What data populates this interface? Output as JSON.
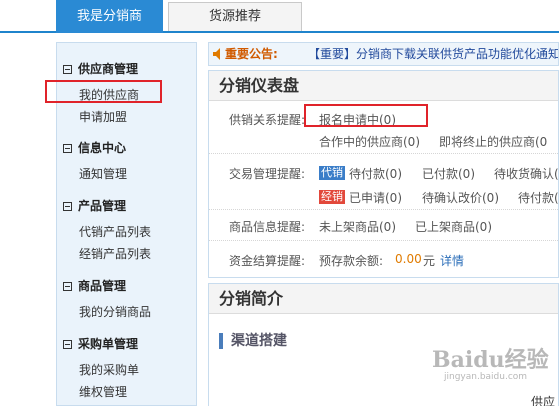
{
  "tabs": {
    "active": "我是分销商",
    "other": "货源推荐"
  },
  "sidebar": {
    "groups": [
      {
        "title": "供应商管理",
        "items": [
          "我的供应商",
          "申请加盟"
        ]
      },
      {
        "title": "信息中心",
        "items": [
          "通知管理"
        ]
      },
      {
        "title": "产品管理",
        "items": [
          "代销产品列表",
          "经销产品列表"
        ]
      },
      {
        "title": "商品管理",
        "items": [
          "我的分销商品"
        ]
      },
      {
        "title": "采购单管理",
        "items": [
          "我的采购单",
          "维权管理"
        ]
      }
    ]
  },
  "notice": {
    "label": "重要公告:",
    "message": "【重要】分销商下载关联供货产品功能优化通知"
  },
  "dashboard": {
    "title": "分销仪表盘",
    "supply": {
      "label": "供销关系提醒:",
      "applying": "报名申请中(0)",
      "cooperating": "合作中的供应商(0)",
      "ending": "即将终止的供应商(0"
    },
    "trade": {
      "label": "交易管理提醒:",
      "tag_consign": "代销",
      "tag_distribute": "经销",
      "c1": "待付款(0)",
      "c2": "已付款(0)",
      "c3": "待收货确认(",
      "d1": "已申请(0)",
      "d2": "待确认改价(0)",
      "d3": "待付款(0"
    },
    "goods": {
      "label": "商品信息提醒:",
      "off": "未上架商品(0)",
      "on": "已上架商品(0)"
    },
    "funds": {
      "label": "资金结算提醒:",
      "prefix": "预存款余额:",
      "amount": "0.00",
      "unit": "元",
      "detail": "详情"
    }
  },
  "intro": {
    "title": "分销简介",
    "section": "渠道搭建"
  },
  "watermark": {
    "logo": "Baidu经验",
    "sub": "jingyan.baidu.com"
  },
  "corner_text": "供应",
  "colors": {
    "accent": "#2a8ad4",
    "highlight": "#e0232a",
    "amount": "#e07b00"
  }
}
